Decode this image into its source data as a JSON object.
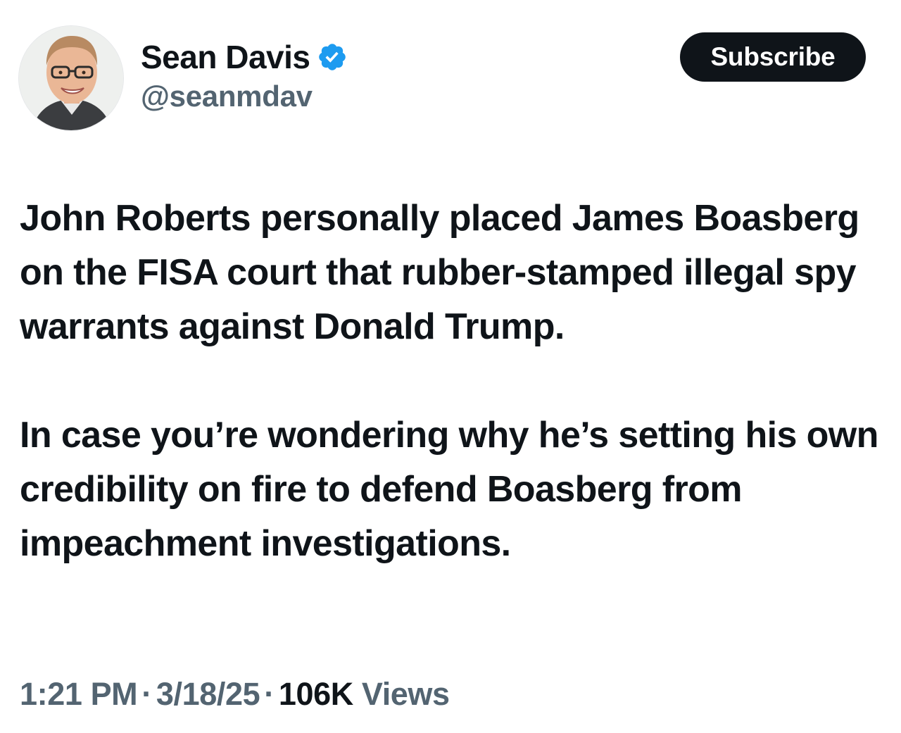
{
  "author": {
    "display_name": "Sean Davis",
    "handle": "@seanmdav",
    "verified_icon": "verified-badge-icon"
  },
  "actions": {
    "subscribe_label": "Subscribe"
  },
  "post": {
    "paragraphs": [
      "John Roberts personally placed James Boasberg on the FISA court that rubber-stamped illegal spy warrants against Donald Trump.",
      "In case you’re wondering why he’s setting his own credibility on fire to defend Boasberg from impeachment investigations."
    ]
  },
  "meta": {
    "time": "1:21 PM",
    "date": "3/18/25",
    "separator": "·",
    "views_count": "106K",
    "views_label": "Views"
  },
  "colors": {
    "text_primary": "#0f1419",
    "text_secondary": "#536471",
    "verified_blue": "#1d9bf0",
    "button_bg": "#0f1419",
    "button_text": "#ffffff"
  }
}
